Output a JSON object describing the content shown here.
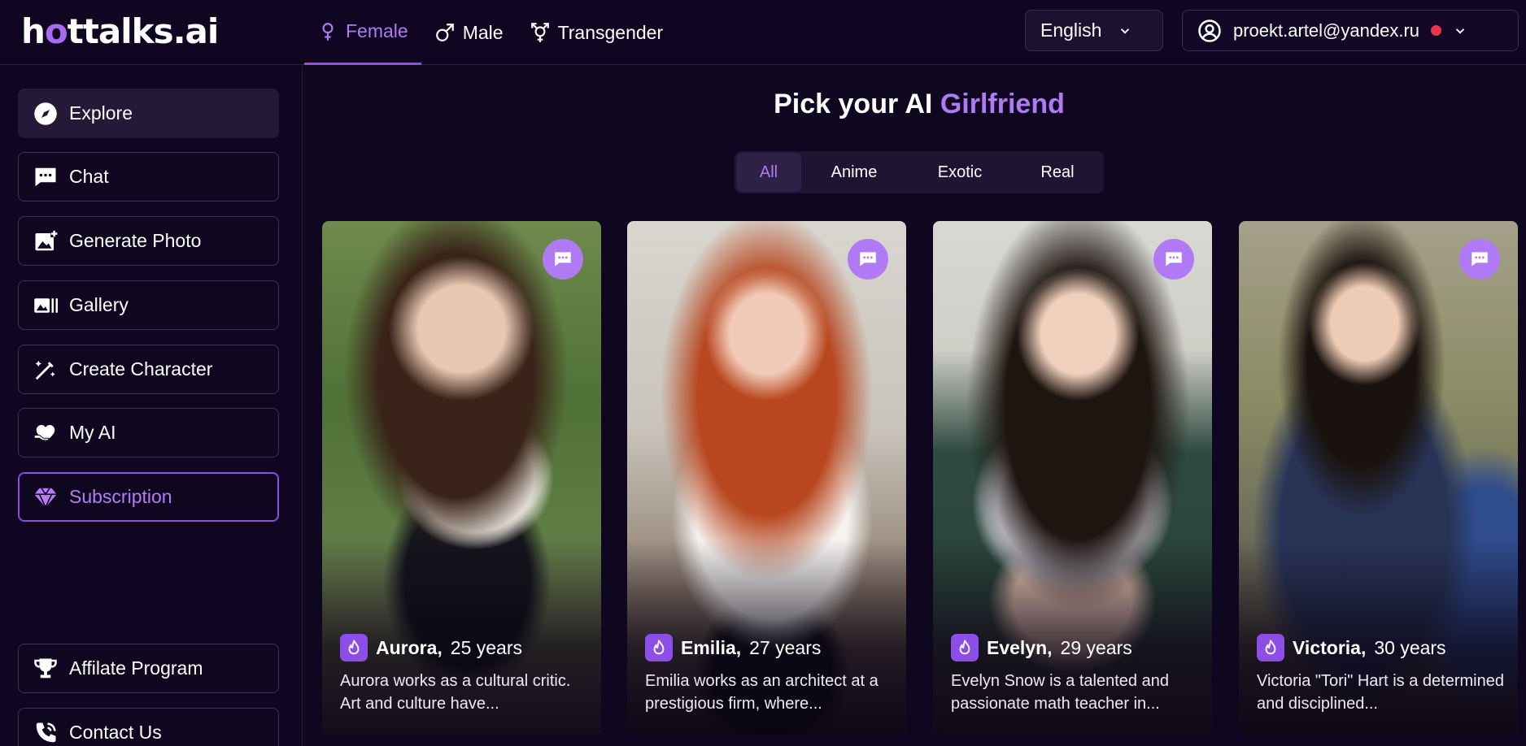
{
  "logo": {
    "part1": "h",
    "accent": "o",
    "part2": "ttalks.ai"
  },
  "gender_tabs": [
    {
      "label": "Female",
      "icon": "female-symbol-icon",
      "active": true
    },
    {
      "label": "Male",
      "icon": "male-symbol-icon",
      "active": false
    },
    {
      "label": "Transgender",
      "icon": "transgender-symbol-icon",
      "active": false
    }
  ],
  "language": {
    "value": "English"
  },
  "user": {
    "email": "proekt.artel@yandex.ru"
  },
  "sidebar": {
    "items": [
      {
        "label": "Explore",
        "icon": "compass-icon"
      },
      {
        "label": "Chat",
        "icon": "chat-icon"
      },
      {
        "label": "Generate Photo",
        "icon": "image-plus-icon"
      },
      {
        "label": "Gallery",
        "icon": "gallery-icon"
      },
      {
        "label": "Create Character",
        "icon": "magic-wand-icon"
      },
      {
        "label": "My AI",
        "icon": "heart-hand-icon"
      },
      {
        "label": "Subscription",
        "icon": "diamond-icon"
      }
    ],
    "bottom_items": [
      {
        "label": "Affilate Program",
        "icon": "trophy-icon"
      },
      {
        "label": "Contact Us",
        "icon": "phone-icon"
      }
    ]
  },
  "main": {
    "heading_prefix": "Pick your AI",
    "heading_accent": "Girlfriend",
    "filters": [
      "All",
      "Anime",
      "Exotic",
      "Real"
    ],
    "active_filter": "All"
  },
  "cards": [
    {
      "name": "Aurora,",
      "age": "25 years",
      "description": "Aurora works as a cultural critic. Art and culture have..."
    },
    {
      "name": "Emilia,",
      "age": "27 years",
      "description": "Emilia works as an architect at a prestigious firm, where..."
    },
    {
      "name": "Evelyn,",
      "age": "29 years",
      "description": "Evelyn Snow is a talented and passionate math teacher in..."
    },
    {
      "name": "Victoria,",
      "age": "30 years",
      "description": "Victoria \"Tori\" Hart is a determined and disciplined..."
    }
  ],
  "colors": {
    "accent": "#b07af5",
    "background": "#0f0620",
    "badge": "#8b4ee6",
    "status_dot": "#f0334d"
  }
}
